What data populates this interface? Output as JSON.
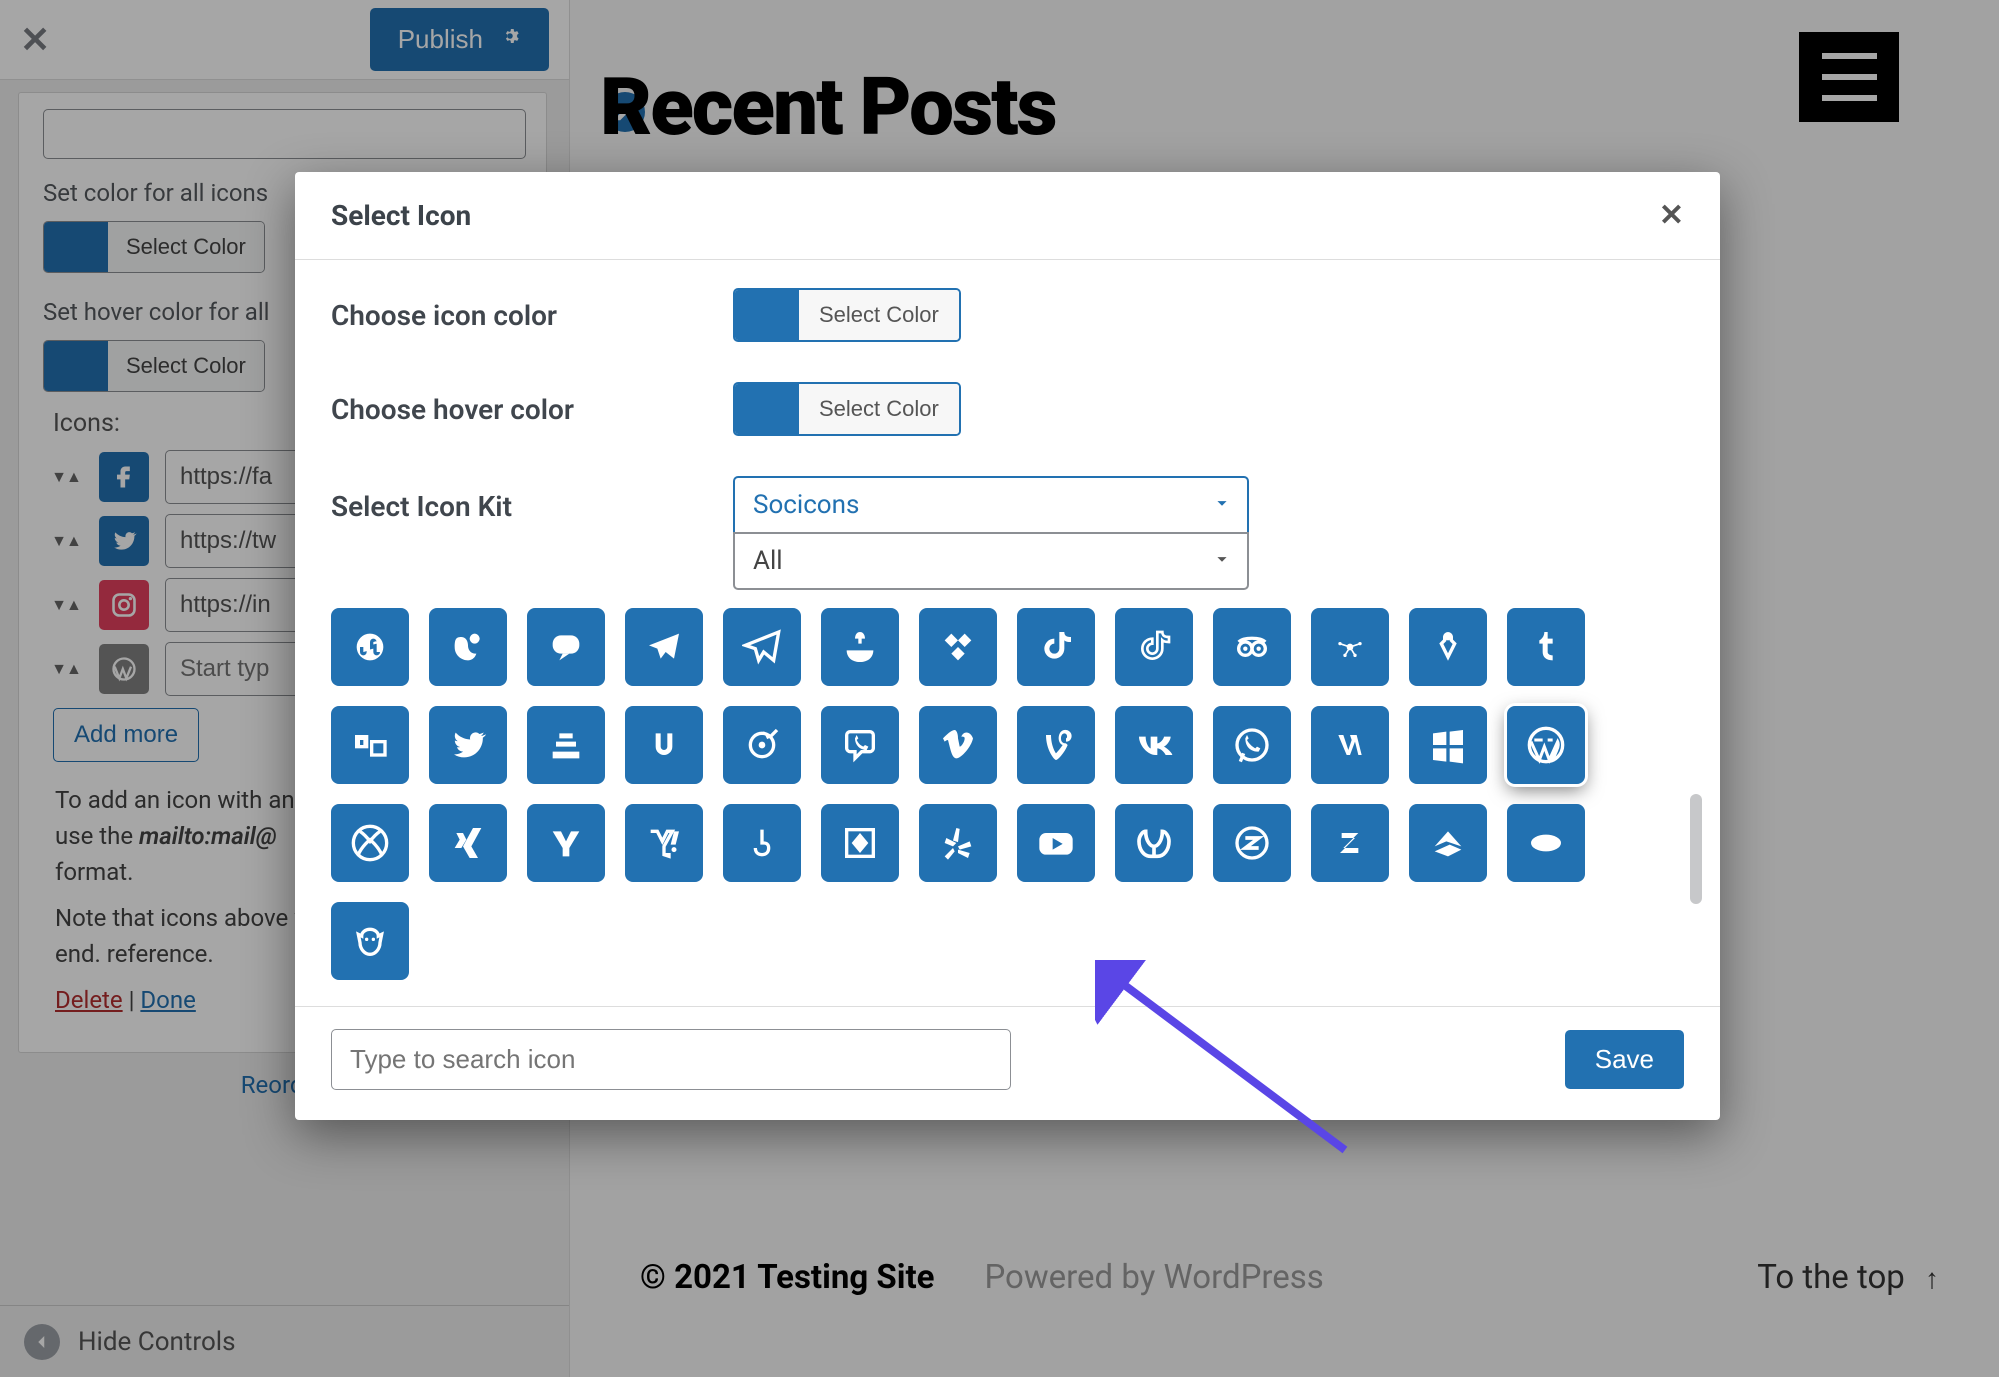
{
  "panel": {
    "close_glyph": "✕",
    "publish_label": "Publish",
    "gear_glyph": "✿",
    "set_color_label": "Set color for all icons",
    "set_hover_label": "Set hover color for all",
    "select_color_label": "Select Color",
    "icons_label": "Icons:",
    "rows": [
      {
        "url": "https://fa"
      },
      {
        "url": "https://tw"
      },
      {
        "url": "https://in"
      },
      {
        "url": "Start typ"
      }
    ],
    "add_more_label": "Add more",
    "note1_pre": "To add an icon with an",
    "note1_mid_prefix": "use the ",
    "note1_mid_italic": "mailto:mail@",
    "note1_post": "format.",
    "note2": "Note that icons above will look on front-end. reference.",
    "delete_label": "Delete",
    "done_label": "Done",
    "divider": " | ",
    "reorder_label": "Reorder",
    "hide_controls_label": "Hide Controls"
  },
  "preview": {
    "page_title": "Recent Posts",
    "footer_copyright": "© 2021 Testing Site",
    "footer_powered": "Powered by WordPress",
    "footer_to_top": "To the top",
    "up_arrow": "↑"
  },
  "modal": {
    "title": "Select Icon",
    "close_glyph": "✕",
    "choose_icon_color_label": "Choose icon color",
    "choose_hover_color_label": "Choose hover color",
    "select_icon_kit_label": "Select Icon Kit",
    "select_color_label": "Select Color",
    "kit_value": "Socicons",
    "filter_value": "All",
    "search_placeholder": "Type to search icon",
    "save_label": "Save",
    "icons": [
      "stumbleupon",
      "swarm",
      "chat",
      "telegram",
      "telegram-plane",
      "thumb",
      "tidal",
      "tiktok",
      "tiktok-alt",
      "tripadvisor",
      "sparkle",
      "fork",
      "tumblr",
      "tunein",
      "twitter",
      "stack",
      "u-logo",
      "target",
      "viber",
      "vimeo",
      "vine",
      "vk",
      "whatsapp",
      "wikipedia",
      "windows",
      "wordpress",
      "xbox",
      "xing",
      "yahoo",
      "yahoo-alt",
      "y-pipe",
      "diamond",
      "yelp",
      "youtube",
      "y-curl",
      "zazzle",
      "z-logo",
      "zillow",
      "zomato",
      "zynga"
    ]
  },
  "colors": {
    "accent": "#2271b1",
    "arrow": "#5a46e6"
  }
}
